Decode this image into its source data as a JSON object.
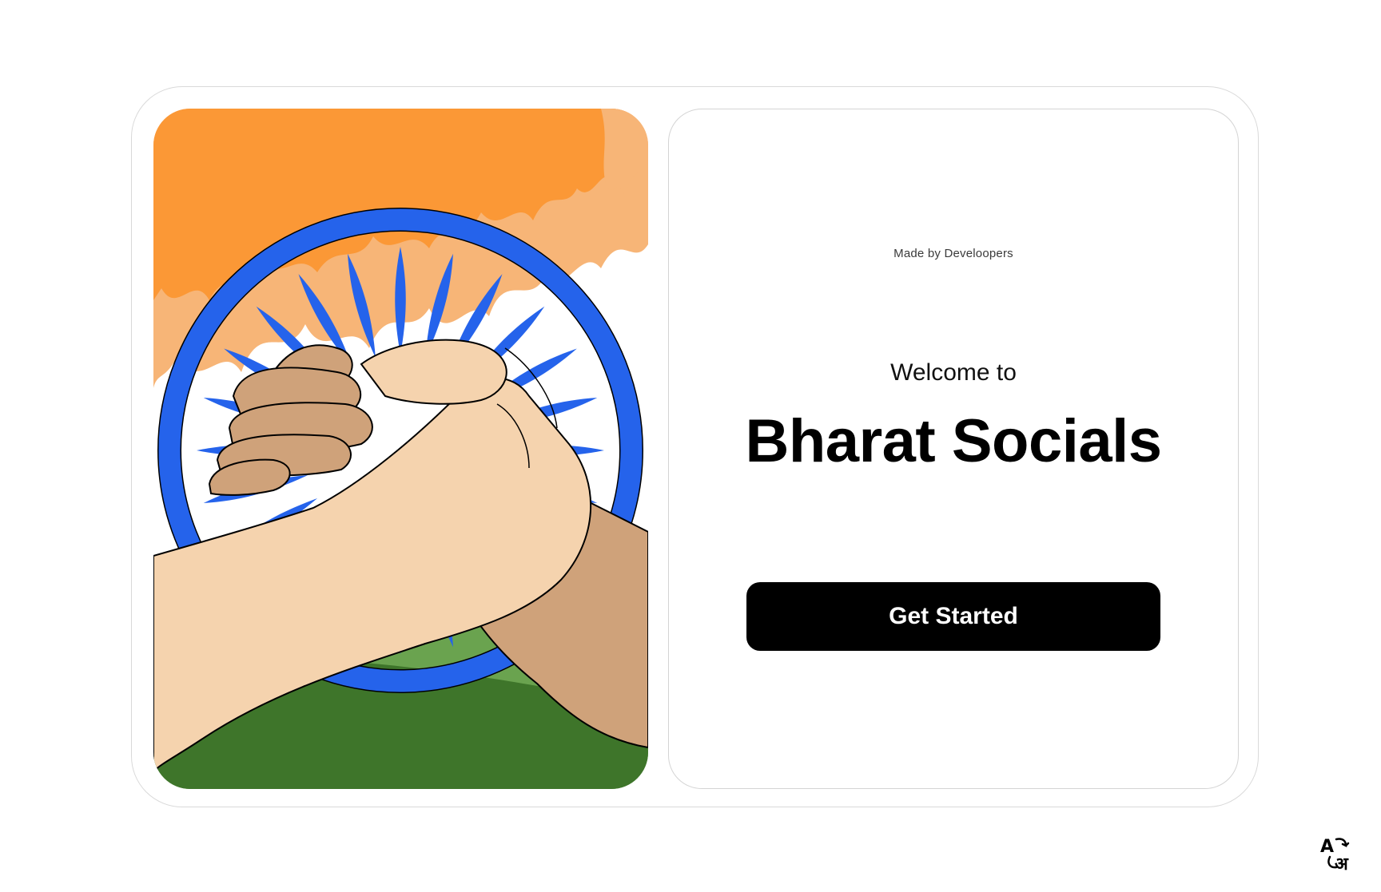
{
  "credit": "Made by Develoopers",
  "welcome": "Welcome to",
  "brand": "Bharat Socials",
  "cta_label": "Get Started",
  "lang_toggle": {
    "icon": "language-translate-icon",
    "latin": "A",
    "devanagari": "अ"
  },
  "illustration": {
    "icon": "handshake-illustration",
    "colors": {
      "saffron": "#FB9836",
      "light_saffron": "#F7B577",
      "chakra": "#2563EB",
      "green": "#3E752A",
      "light_green": "#6AA34F",
      "skin_light": "#F5D3AE",
      "skin_dark": "#CFA27A"
    }
  }
}
